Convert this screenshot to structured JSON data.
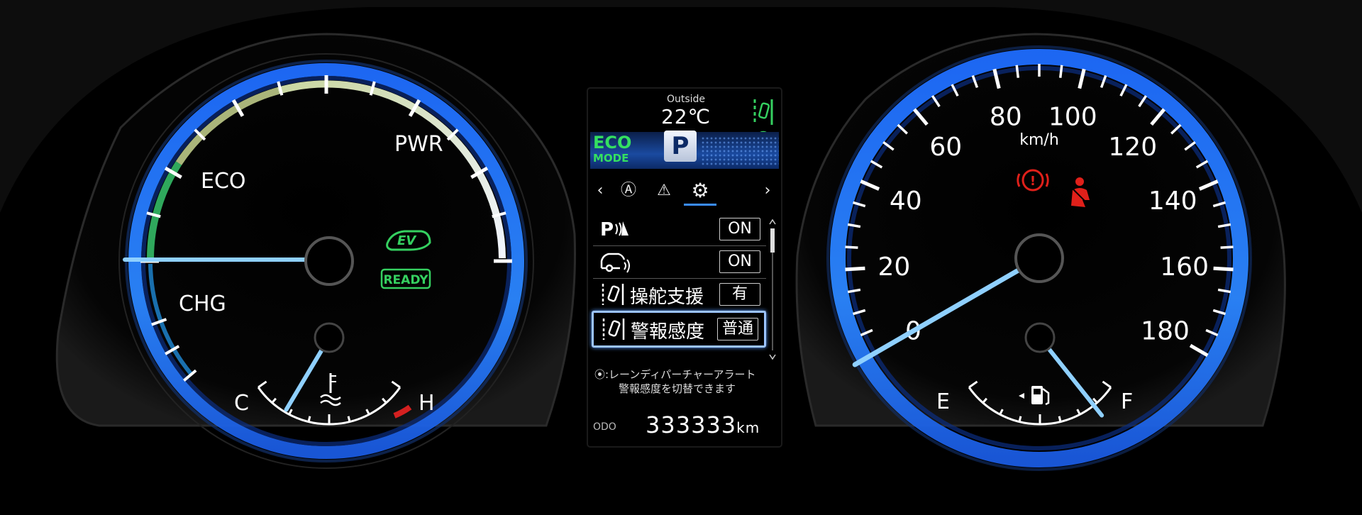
{
  "left_gauge": {
    "labels": {
      "eco": "ECO",
      "pwr": "PWR",
      "chg": "CHG"
    },
    "indicators": {
      "ev": "EV",
      "ready": "READY"
    },
    "temp_gauge": {
      "cold_label": "C",
      "hot_label": "H",
      "icon": "coolant-temperature-icon",
      "level": 0.22
    }
  },
  "center_display": {
    "outside_label": "Outside",
    "outside_temp": "22℃",
    "drive_mode_label": "ECO",
    "drive_mode_sub": "MODE",
    "gear": "P",
    "tabs": [
      {
        "icon": "chevron-left-icon",
        "label": "‹"
      },
      {
        "icon": "auto-icon",
        "label": "Ⓐ"
      },
      {
        "icon": "warning-icon",
        "label": "⚠"
      },
      {
        "icon": "settings-icon",
        "label": "⚙",
        "active": true
      },
      {
        "icon": "chevron-right-icon",
        "label": "›"
      }
    ],
    "settings": [
      {
        "icon": "parking-sensor-icon",
        "label": "",
        "value": "ON"
      },
      {
        "icon": "rear-cross-traffic-icon",
        "label": "",
        "value": "ON"
      },
      {
        "icon": "lane-assist-icon",
        "label": "操舵支援",
        "value": "有"
      },
      {
        "icon": "lane-assist-icon",
        "label": "警報感度",
        "value": "普通",
        "selected": true
      }
    ],
    "hint_line1": "⦿:レーンディパーチャーアラート",
    "hint_line2": "警報感度を切替できます",
    "odo_label": "ODO",
    "odo_value": "333333",
    "odo_unit": "km"
  },
  "speedometer": {
    "unit": "km/h",
    "ticks": [
      "0",
      "20",
      "40",
      "60",
      "80",
      "100",
      "120",
      "140",
      "160",
      "180"
    ],
    "speed": 0,
    "warnings": [
      "parking-brake-icon",
      "seatbelt-icon"
    ],
    "fuel_gauge": {
      "empty_label": "E",
      "full_label": "F",
      "icon": "fuel-pump-icon",
      "level": 0.85
    }
  },
  "colors": {
    "ring": "#2f7dff",
    "needle": "#7cc8ff",
    "eco_arc": "#2ea860",
    "warning": "#e0201a",
    "ready": "#35d060"
  }
}
